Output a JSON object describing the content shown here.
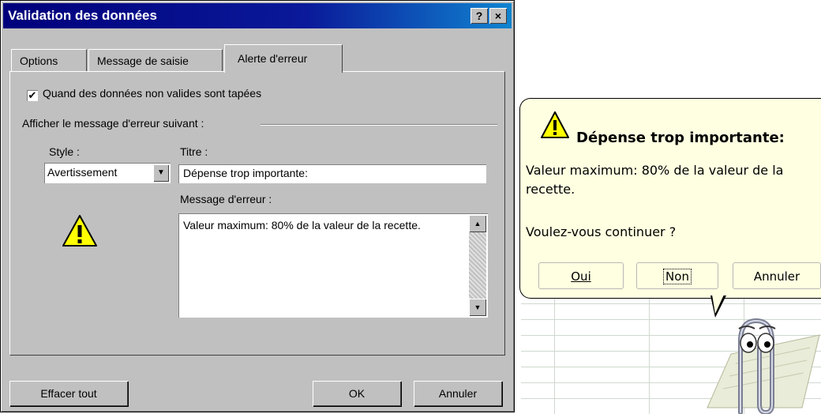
{
  "dialog": {
    "title": "Validation des données",
    "help_button": "?",
    "close_button": "×",
    "tabs": [
      {
        "label": "Options"
      },
      {
        "label": "Message de saisie"
      },
      {
        "label": "Alerte d'erreur"
      }
    ],
    "checkbox": {
      "label": "Quand des données non valides sont tapées",
      "checked": true,
      "mark": "✔"
    },
    "group_label": "Afficher le message d'erreur suivant :",
    "style_label": "Style :",
    "style_value": "Avertissement",
    "titre_label": "Titre :",
    "titre_value": "Dépense trop importante:",
    "message_label": "Message d'erreur :",
    "message_value": "Valeur maximum: 80% de la valeur de la recette.",
    "buttons": {
      "clear": "Effacer tout",
      "ok": "OK",
      "cancel": "Annuler"
    },
    "icon": "warning-icon"
  },
  "balloon": {
    "title": "Dépense trop importante:",
    "message": "Valeur maximum: 80% de la valeur de la\nrecette.",
    "question": "Voulez-vous continuer ?",
    "buttons": {
      "yes": "Oui",
      "no": "Non",
      "cancel": "Annuler"
    },
    "icon": "warning-icon",
    "assistant": "paperclip-assistant",
    "background_color": "#ffffe1"
  },
  "colors": {
    "titlebar": "#00007b",
    "face": "#c0c0c0",
    "warning_yellow": "#ffff00"
  }
}
